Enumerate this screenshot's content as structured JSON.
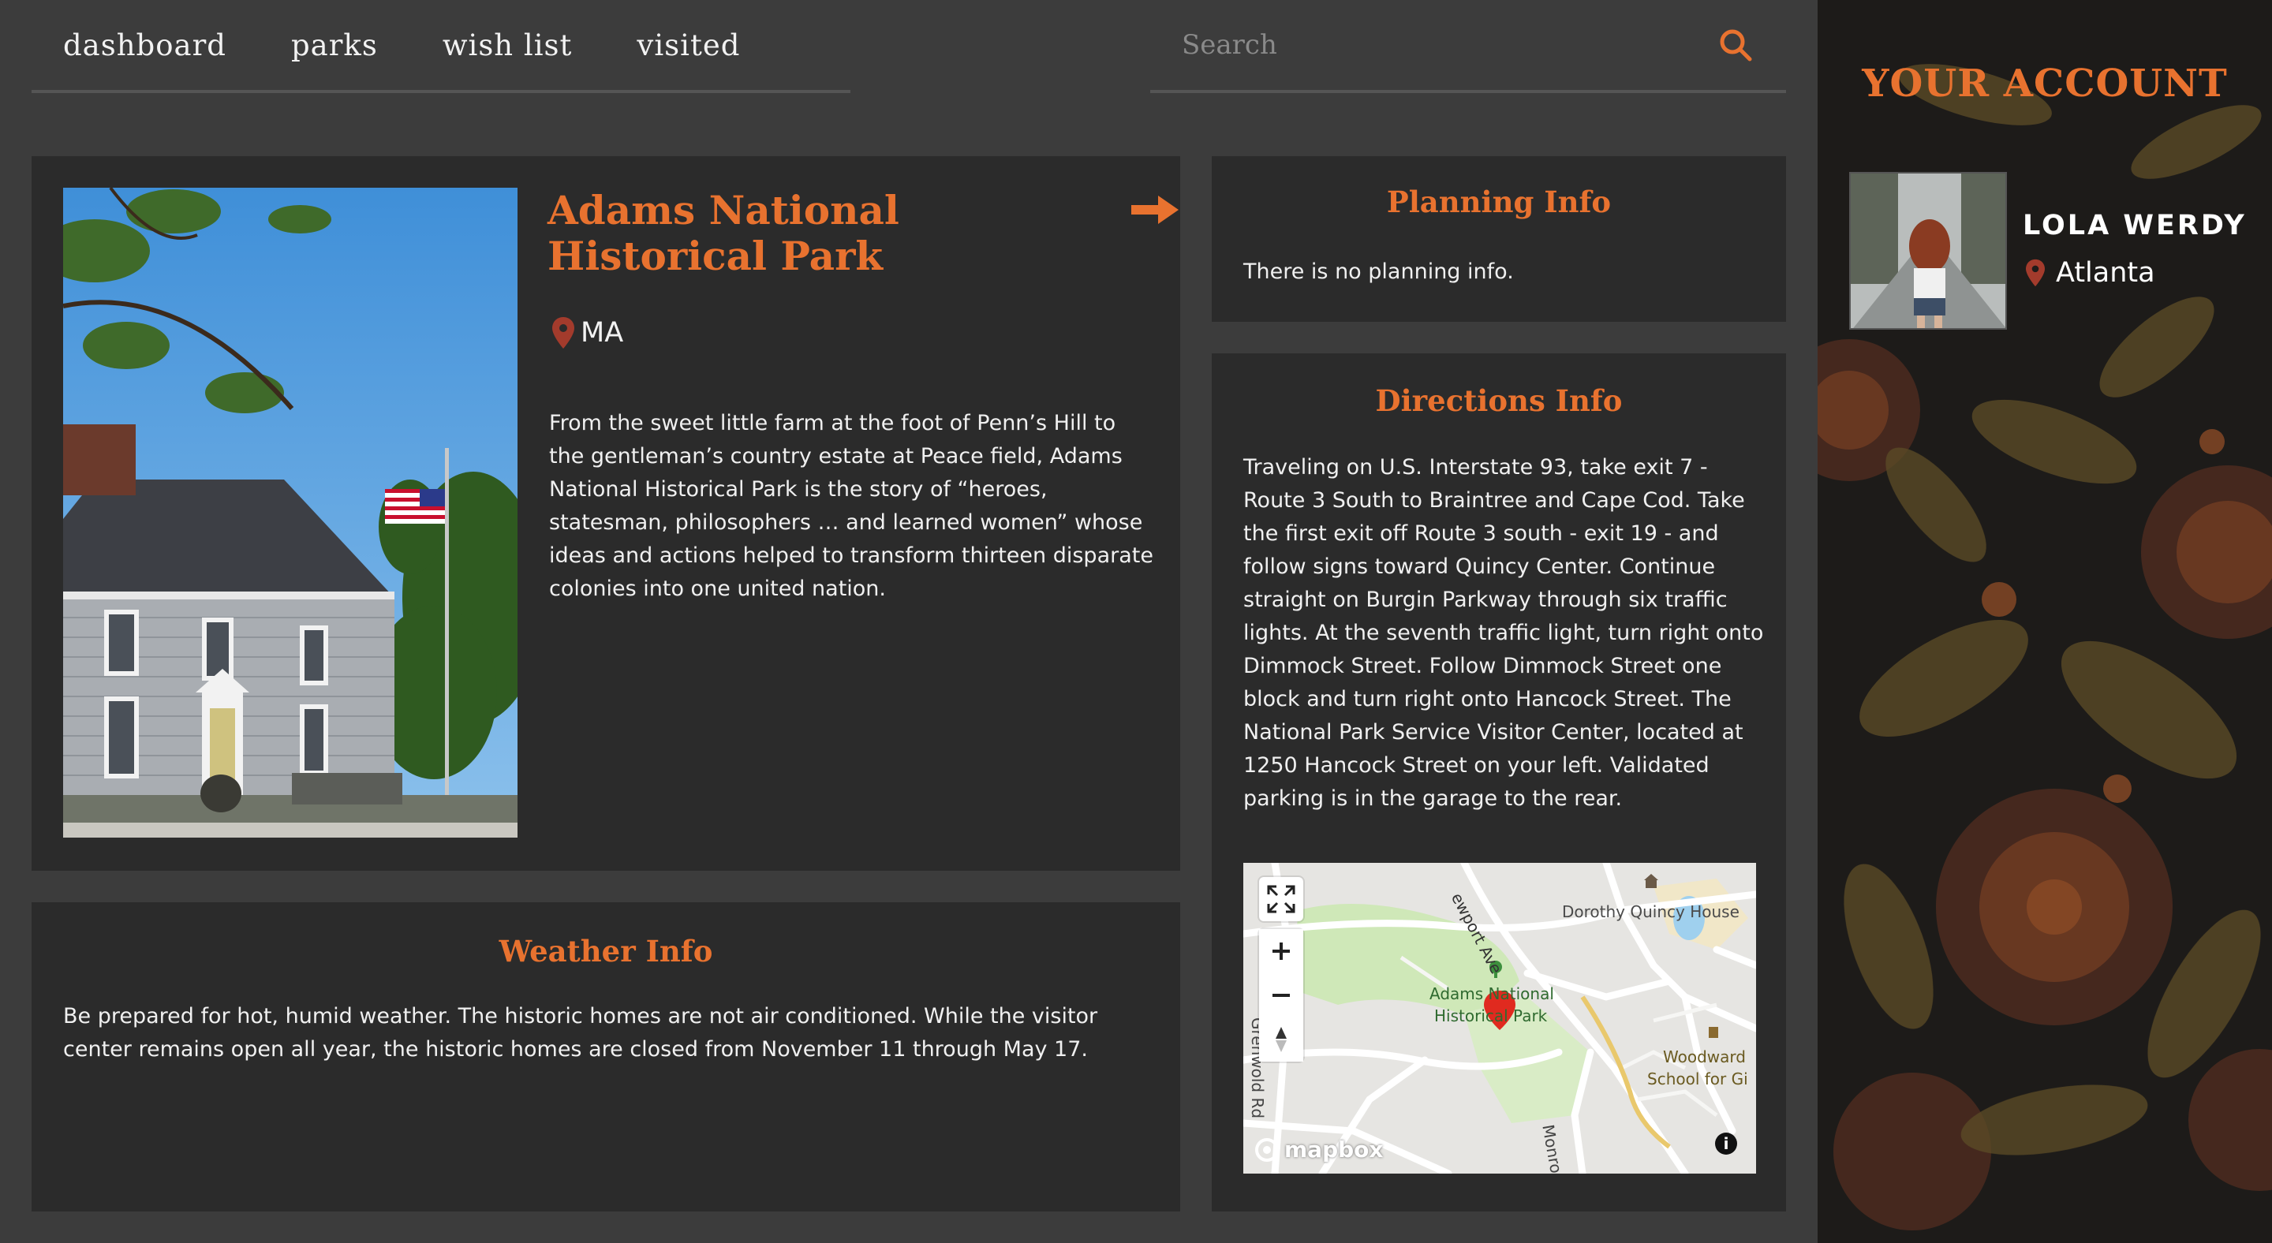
{
  "nav": {
    "items": [
      {
        "label": "dashboard"
      },
      {
        "label": "parks"
      },
      {
        "label": "wish list"
      },
      {
        "label": "visited"
      }
    ]
  },
  "search": {
    "placeholder": "Search",
    "icon": "search-icon"
  },
  "park": {
    "name": "Adams National Historical Park",
    "state": "MA",
    "description": "From the sweet little farm at the foot of Penn’s Hill to the gentleman’s country estate at Peace field, Adams National Historical Park is the story of “heroes, statesman, philosophers … and learned women” whose ideas and actions helped to transform thirteen disparate colonies into one united nation."
  },
  "weather": {
    "title": "Weather Info",
    "text": "Be prepared for hot, humid weather. The historic homes are not air conditioned. While the visitor center remains open all year, the historic homes are closed from November 11 through May 17."
  },
  "planning": {
    "title": "Planning Info",
    "text": "There is no planning info."
  },
  "directions": {
    "title": "Directions Info",
    "text": "Traveling on U.S. Interstate 93, take exit 7 - Route 3 South to Braintree and Cape Cod. Take the first exit off Route 3 south - exit 19 - and follow signs toward Quincy Center. Continue straight on Burgin Parkway through six traffic lights. At the seventh traffic light, turn right onto Dimmock Street. Follow Dimmock Street one block and turn right onto Hancock Street. The National Park Service Visitor Center, located at 1250 Hancock Street on your left. Validated parking is in the garage to the rear."
  },
  "map": {
    "labels": {
      "newport": "ewport Ave",
      "dorothy": "Dorothy Quincy House",
      "adams_line1": "Adams National",
      "adams_line2": "Historical Park",
      "woodward_line1": "Woodward",
      "woodward_line2": "School for Gi",
      "grenwold": "Grenwold Rd",
      "monroe": "Monro"
    },
    "attribution": "mapbox"
  },
  "account": {
    "title": "YOUR ACCOUNT",
    "name": "LOLA WERDY",
    "location": "Atlanta"
  },
  "colors": {
    "accent": "#e8722f",
    "card": "#2b2b2b",
    "background": "#3c3c3c"
  }
}
